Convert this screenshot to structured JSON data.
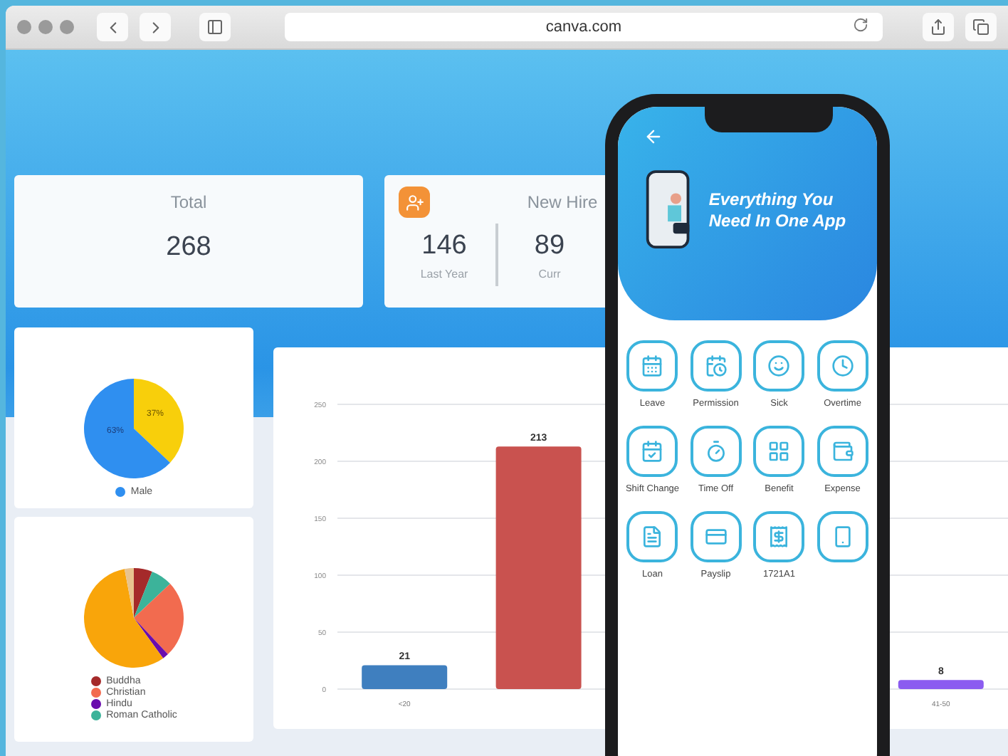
{
  "browser": {
    "address": "canva.com"
  },
  "cards": [
    {
      "kind": "single",
      "title": "Total",
      "value": "268"
    },
    {
      "kind": "split",
      "title": "New Hire",
      "values": [
        {
          "value": "146",
          "caption": "Last Year"
        },
        {
          "value": "89",
          "caption": "Curr"
        }
      ]
    }
  ],
  "gender_pie": {
    "slice_labels": [
      "63%",
      "37%"
    ],
    "legend": [
      {
        "label": "Male",
        "color": "#2f8ff0"
      }
    ]
  },
  "religion_pie": {
    "legend": [
      {
        "label": "Buddha",
        "color": "#a52a2a"
      },
      {
        "label": "Christian",
        "color": "#f26b4f"
      },
      {
        "label": "Hindu",
        "color": "#6a0dad"
      },
      {
        "label": "Roman Catholic",
        "color": "#3cb39a"
      }
    ]
  },
  "bar_chart": {
    "chart_data": {
      "type": "bar",
      "categories": [
        "<20",
        null,
        null,
        null,
        "41-50"
      ],
      "values": [
        21,
        213,
        null,
        null,
        8
      ],
      "grid": true,
      "ylim": [
        0,
        250
      ],
      "yticks": [
        0,
        50,
        100,
        150,
        200,
        250
      ],
      "data_labels": true
    }
  },
  "phone": {
    "headline": "Everything You Need In One App",
    "tiles": [
      {
        "kind": "labeled",
        "label": "Leave"
      },
      {
        "kind": "labeled",
        "label": "Permission"
      },
      {
        "kind": "labeled",
        "label": "Sick"
      },
      {
        "kind": "labeled",
        "label": "Overtime"
      },
      {
        "kind": "labeled",
        "label": "Shift Change"
      },
      {
        "kind": "labeled",
        "label": "Time Off"
      },
      {
        "kind": "labeled",
        "label": "Benefit"
      },
      {
        "kind": "labeled",
        "label": "Expense"
      },
      {
        "kind": "labeled",
        "label": "Loan"
      },
      {
        "kind": "labeled",
        "label": "Payslip"
      },
      {
        "kind": "labeled",
        "label": "1721A1"
      },
      {
        "kind": "icon_only"
      }
    ]
  }
}
